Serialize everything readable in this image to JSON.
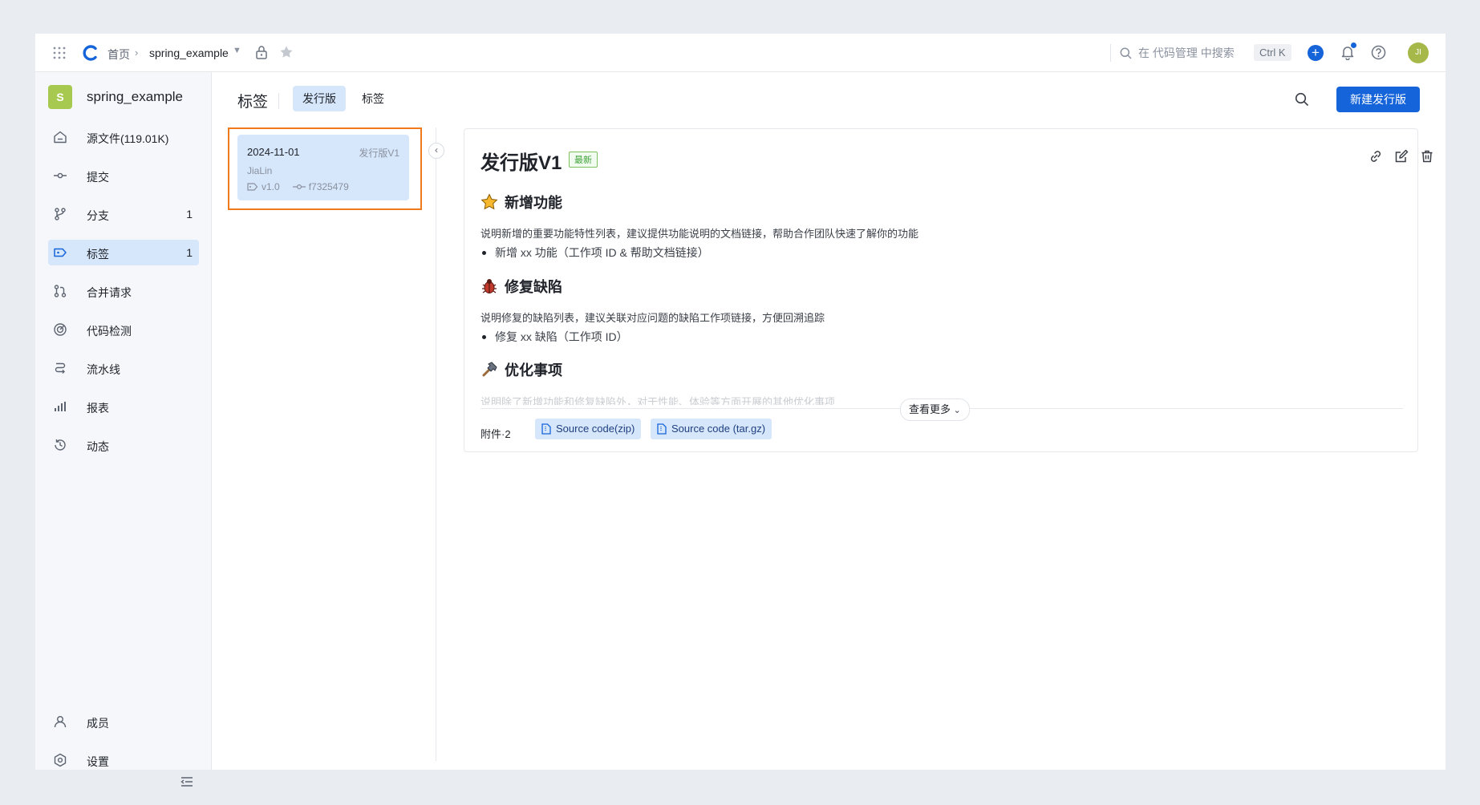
{
  "topbar": {
    "breadcrumb_home": "首页",
    "breadcrumb_sep": "›",
    "repo": "spring_example",
    "search_placeholder": "在 代码管理 中搜索",
    "shortcut": "Ctrl K",
    "avatar_initials": "JI"
  },
  "sidebar": {
    "repo_initial": "S",
    "repo_name": "spring_example",
    "items": [
      {
        "label": "源文件(119.01K)",
        "count": "",
        "icon": "home-icon"
      },
      {
        "label": "提交",
        "count": "",
        "icon": "commit-icon"
      },
      {
        "label": "分支",
        "count": "1",
        "icon": "branch-icon"
      },
      {
        "label": "标签",
        "count": "1",
        "icon": "tag-icon",
        "active": true
      },
      {
        "label": "合并请求",
        "count": "",
        "icon": "merge-request-icon"
      },
      {
        "label": "代码检测",
        "count": "",
        "icon": "scan-icon"
      },
      {
        "label": "流水线",
        "count": "",
        "icon": "pipeline-icon"
      },
      {
        "label": "报表",
        "count": "",
        "icon": "chart-icon"
      },
      {
        "label": "动态",
        "count": "",
        "icon": "history-icon"
      }
    ],
    "bottom": [
      {
        "label": "成员",
        "icon": "user-icon"
      },
      {
        "label": "设置",
        "icon": "settings-icon"
      }
    ]
  },
  "header": {
    "title": "标签",
    "tabs": [
      {
        "label": "发行版",
        "active": true
      },
      {
        "label": "标签",
        "active": false
      }
    ],
    "new_release_button": "新建发行版"
  },
  "release_list": [
    {
      "date": "2024-11-01",
      "name": "发行版V1",
      "author": "JiaLin",
      "tag": "v1.0",
      "commit": "f7325479"
    }
  ],
  "detail": {
    "title": "发行版V1",
    "badge": "最新",
    "sections": [
      {
        "icon": "star-emoji",
        "heading": "新增功能",
        "desc": "说明新增的重要功能特性列表，建议提供功能说明的文档链接，帮助合作团队快速了解你的功能",
        "item": "新增 xx 功能（工作项 ID & 帮助文档链接）"
      },
      {
        "icon": "bug-emoji",
        "heading": "修复缺陷",
        "desc": "说明修复的缺陷列表，建议关联对应问题的缺陷工作项链接，方便回溯追踪",
        "item": "修复 xx 缺陷（工作项 ID）"
      },
      {
        "icon": "hammer-emoji",
        "heading": "优化事项",
        "desc": "说明除了新增功能和修复缺陷外，对于性能、体验等方面开展的其他优化事项"
      }
    ],
    "more_button": "查看更多",
    "attachments_label": "附件·2",
    "attachments": [
      "Source code(zip)",
      "Source code (tar.gz)"
    ]
  },
  "colors": {
    "accent": "#1664d9",
    "active_bg": "#d6e6fb",
    "highlight": "#f07a1b",
    "badge_green": "#3fa33b"
  }
}
